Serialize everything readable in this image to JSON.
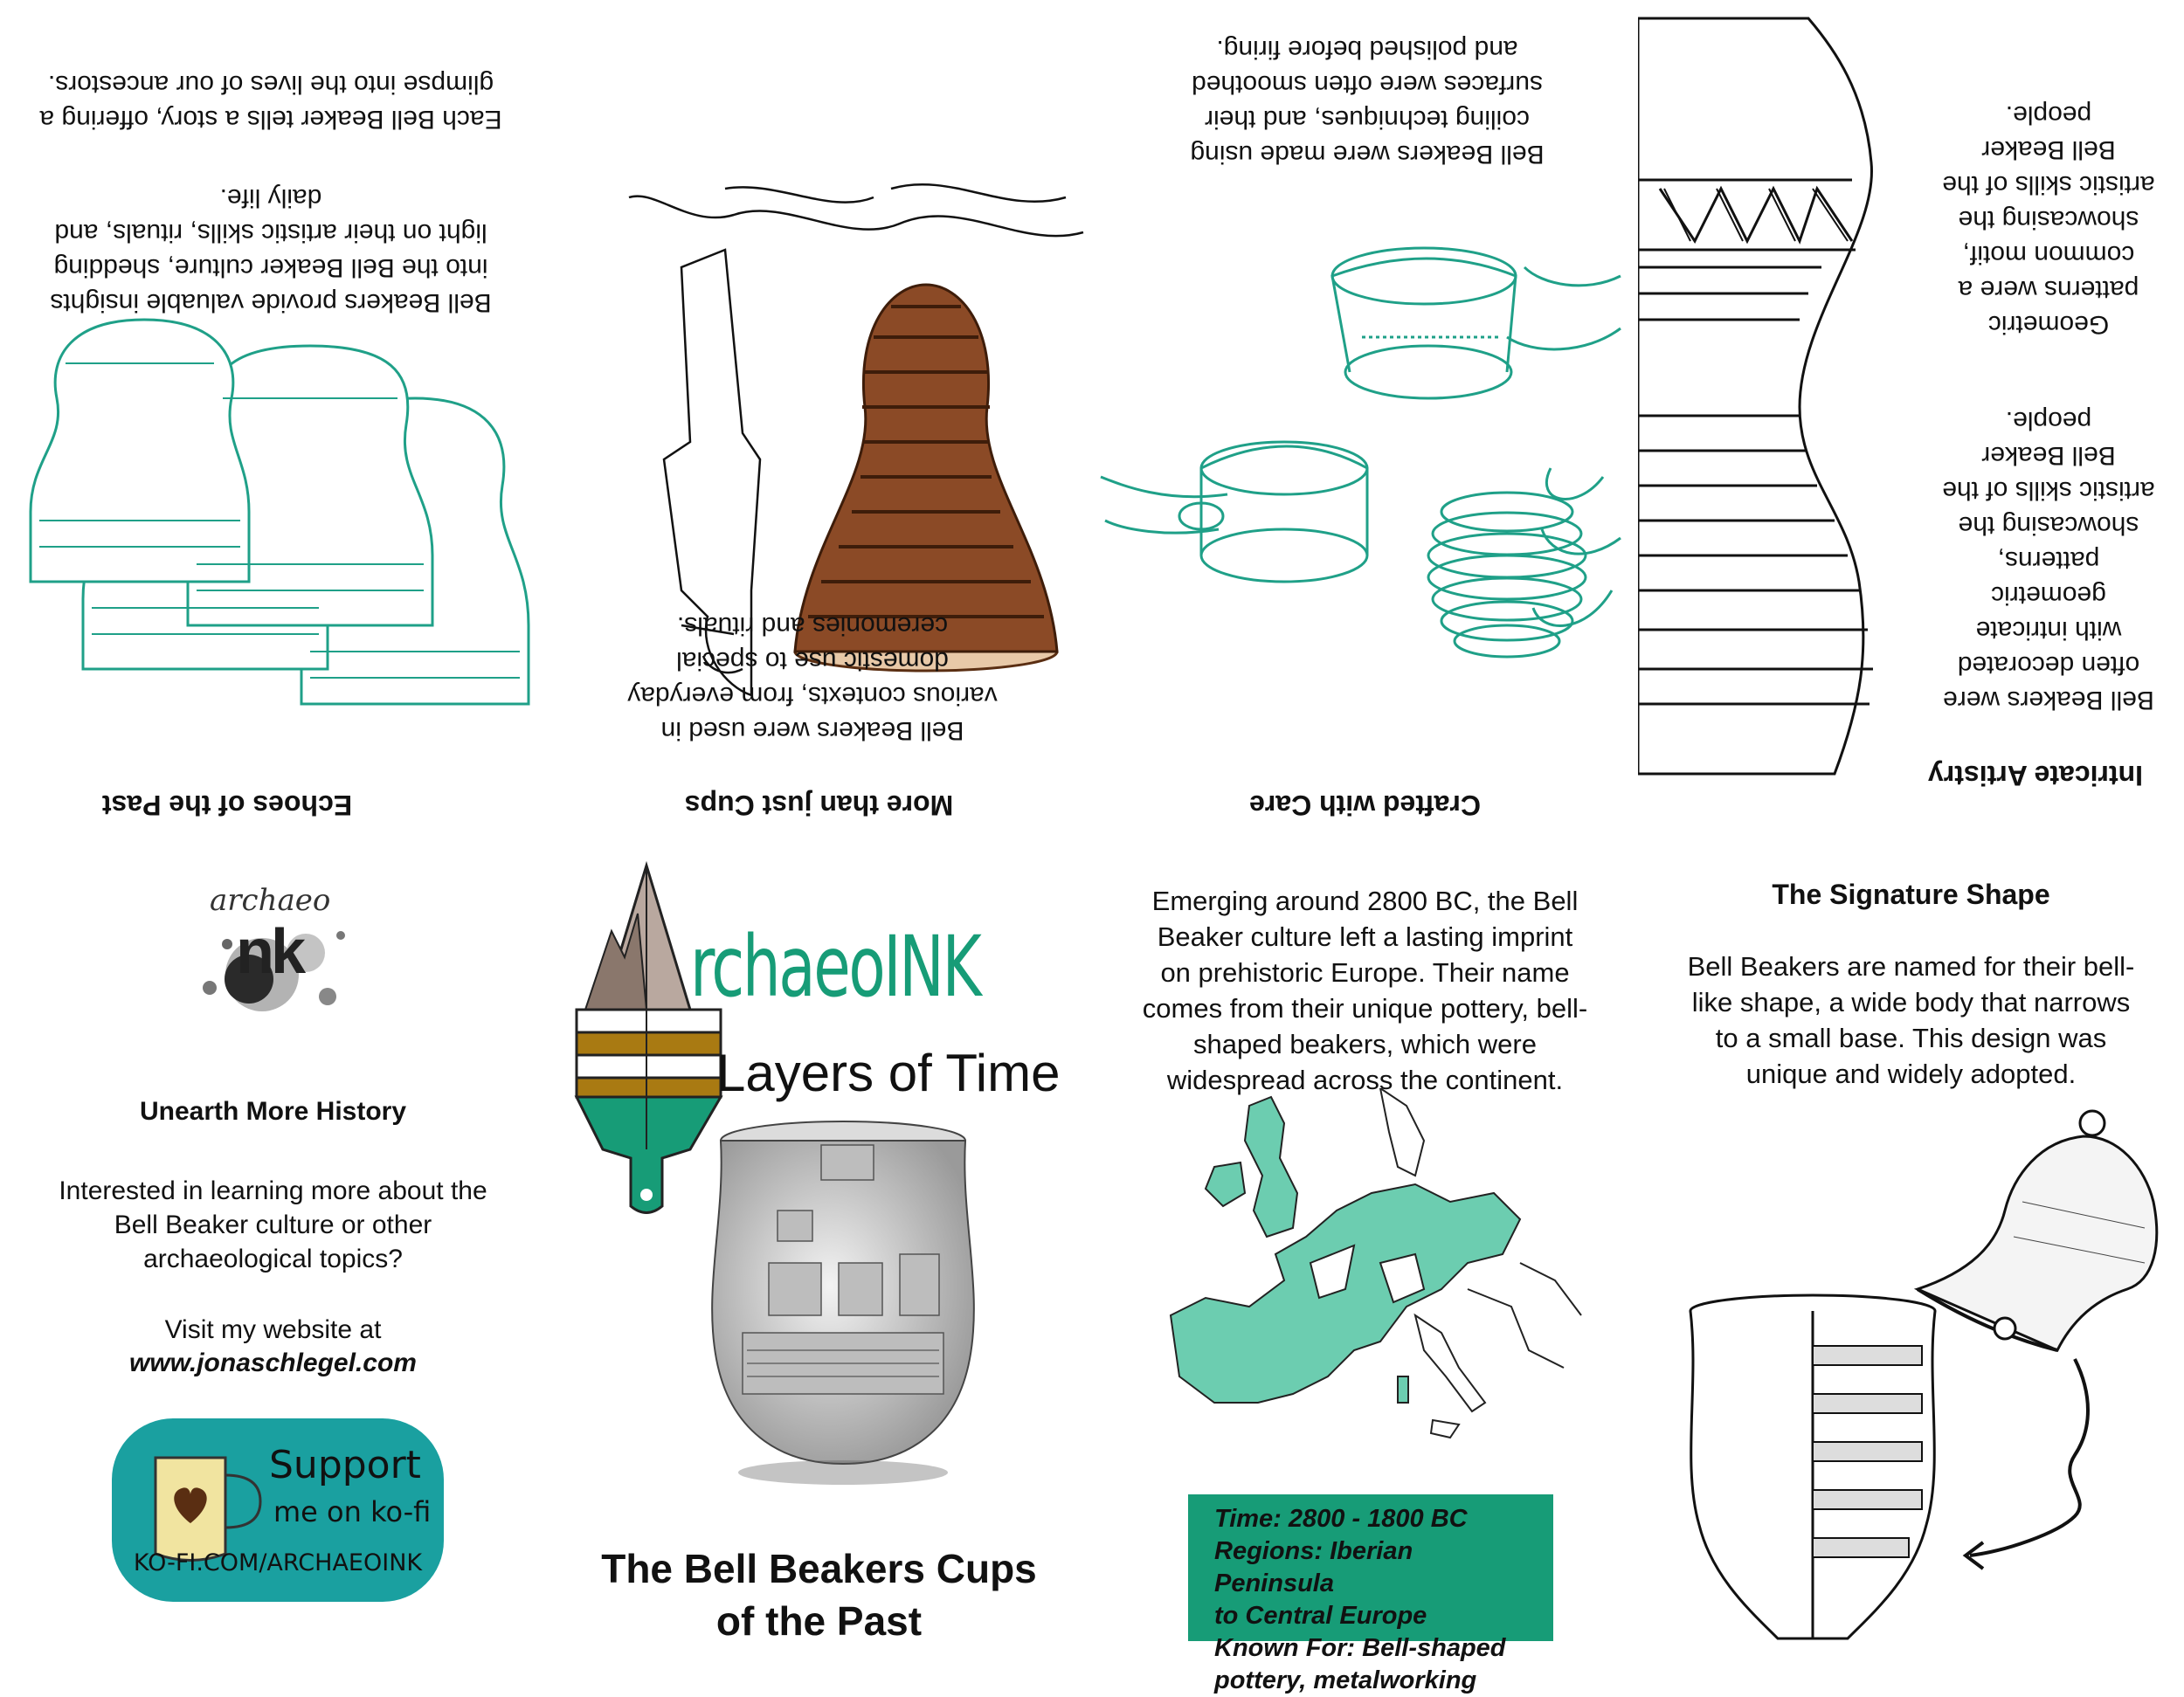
{
  "intricate_artistry": {
    "heading": "Intricate Artistry",
    "text_a": "Bell Beakers were often decorated with intricate geometric patterns, showcasing the artistic skills of the Bell Beaker people.",
    "text_b": "Geometric patterns were a common motif, showcasing the artistic skills of the Bell Beaker people."
  },
  "crafted_with_care": {
    "heading": "Crafted with Care",
    "text": "Bell Beakers were made using coiling techniques, and their surfaces were often smoothed and polished before firing."
  },
  "more_than_cups": {
    "heading": "More than just Cups",
    "text": "Bell Beakers were used in various contexts, from everyday domestic use to special ceremonies and rituals."
  },
  "echoes": {
    "heading": "Echoes of the Past",
    "text_a": "Bell Beakers provide valuable insights into the Bell Beaker culture, shedding light on their artistic skills, rituals, and daily life.",
    "text_b": "Each Bell Beaker tells a story, offering a glimpse into the lives of our ancestors."
  },
  "back": {
    "logo_small_text": "archaeo",
    "logo_small_letters": "nk",
    "heading": "Unearth More History",
    "text": "Interested in learning more about the Bell Beaker culture or other archaeological topics?",
    "visit": "Visit my website at",
    "website": "www.jonaschlegel.com",
    "kofi_line1": "Support",
    "kofi_line2": "me on ko-fi",
    "kofi_url": "KO-FI.COM/ARCHAEOINK"
  },
  "cover": {
    "brand": "rchaeoINK",
    "subtitle": "Layers of Time",
    "title_line1": "The Bell Beakers Cups",
    "title_line2": "of the Past"
  },
  "intro": {
    "text": "Emerging around 2800 BC, the Bell Beaker culture left a lasting imprint on prehistoric Europe. Their name comes from their unique pottery, bell-shaped beakers, which were widespread across the continent.",
    "facts": [
      "Time: 2800 - 1800 BC",
      "Regions: Iberian Peninsula",
      "to Central Europe",
      "Known For: Bell-shaped",
      "pottery, metalworking"
    ]
  },
  "signature": {
    "heading": "The Signature Shape",
    "text": "Bell Beakers are named for their bell-like shape, a wide body that narrows to a small base. This design was unique and widely adopted."
  },
  "colors": {
    "teal": "#1fa088",
    "teal_box": "#179c77",
    "map_fill": "#6ccdb0",
    "kofi_bg": "#1aa0a0",
    "brown": "#8b4a26",
    "brand_tan": "#b9a89f"
  }
}
